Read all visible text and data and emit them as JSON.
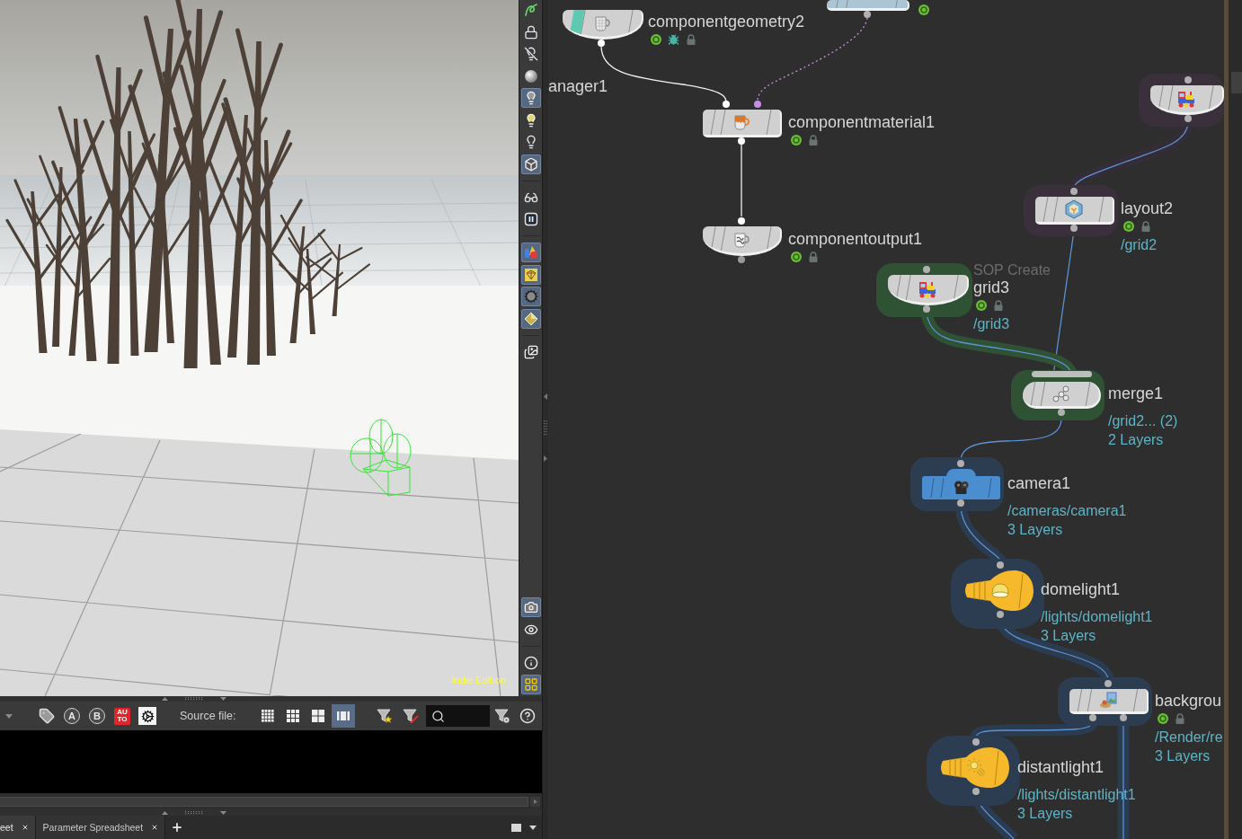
{
  "viewport": {
    "edition_label": "Indie Edition"
  },
  "viewport_toolbar": {
    "groups": [
      {
        "tools": [
          {
            "on": false
          },
          {
            "on": false
          },
          {
            "on": false
          },
          {
            "on": false
          },
          {
            "on": true
          },
          {
            "on": false
          },
          {
            "on": false
          },
          {
            "on": true
          }
        ]
      },
      {
        "tools": [
          {
            "on": false
          },
          {
            "on": false
          }
        ]
      },
      {
        "tools": [
          {
            "on": true
          },
          {
            "on": true
          },
          {
            "on": true
          },
          {
            "on": true
          }
        ]
      },
      {
        "tools": [
          {
            "on": false
          }
        ]
      }
    ],
    "bottom_groups": [
      {
        "tools": [
          {
            "on": true
          },
          {
            "on": false
          }
        ]
      },
      {
        "tools": [
          {
            "on": false
          },
          {
            "on": true
          }
        ]
      }
    ]
  },
  "pane_toolbar": {
    "toggles": [
      {
        "label": "A"
      },
      {
        "label": "B"
      }
    ],
    "auto_button": {
      "label": "AUTO"
    },
    "source_file_label": "Source file:",
    "view_modes": [
      {
        "selected": false
      },
      {
        "selected": false
      },
      {
        "selected": false
      },
      {
        "selected": true
      }
    ]
  },
  "tabs": [
    {
      "label": "eet",
      "selected": true
    },
    {
      "label": "Parameter Spreadsheet",
      "selected": false
    }
  ],
  "network": {
    "nodes": [
      {
        "kind": "box",
        "color": "#a9c5d6",
        "displayed": true
      },
      {
        "name": "componentgeometry2",
        "kind": "dome",
        "color": "#d0d0d0",
        "left_flag": true,
        "displayed": true,
        "debug": true,
        "lock": true
      },
      {
        "name": "anager1",
        "kind": "label"
      },
      {
        "name": "componentmaterial1",
        "kind": "box",
        "color": "#d0d0d0",
        "displayed": true,
        "lock": true
      },
      {
        "kind": "dome",
        "color": "#d0d0d0",
        "halo": {
          "color": "#39303b"
        }
      },
      {
        "name": "componentoutput1",
        "kind": "dome",
        "color": "#d0d0d0",
        "displayed": true,
        "lock": true
      },
      {
        "name": "layout2",
        "kind": "box",
        "color": "#d0d0d0",
        "halo": {
          "color": "#39303b"
        },
        "displayed": true,
        "lock": true,
        "path": "/grid2"
      },
      {
        "subtitle": "SOP Create",
        "name": "grid3",
        "kind": "dome",
        "color": "#d0d0d0",
        "halo": {
          "color": "#2f5234"
        },
        "displayed": true,
        "lock": true,
        "path": "/grid3"
      },
      {
        "name": "merge1",
        "kind": "merge",
        "color": "#d0d0d0",
        "halo": {
          "color": "#2f5234"
        },
        "path": "/grid2... (2)",
        "layers": "2 Layers"
      },
      {
        "name": "camera1",
        "kind": "camera",
        "color": "#4b8ed0",
        "halo": {
          "color": "#2c3d52"
        },
        "path": "/cameras/camera1",
        "layers": "3 Layers"
      },
      {
        "name": "domelight1",
        "kind": "bulb",
        "color": "#f6b92b",
        "halo": {
          "color": "#2c3d52"
        },
        "path": "/lights/domelight1",
        "layers": "3 Layers"
      },
      {
        "name": "backgrou",
        "kind": "box",
        "color": "#d0d0d0",
        "halo": {
          "color": "#2c3d52"
        },
        "displayed": true,
        "lock": true,
        "path": "/Render/re",
        "layers": "3 Layers"
      },
      {
        "name": "distantlight1",
        "kind": "bulb",
        "color": "#f6b92b",
        "halo": {
          "color": "#2c3d52"
        },
        "path": "/lights/distantlight1",
        "layers": "3 Layers"
      }
    ]
  }
}
